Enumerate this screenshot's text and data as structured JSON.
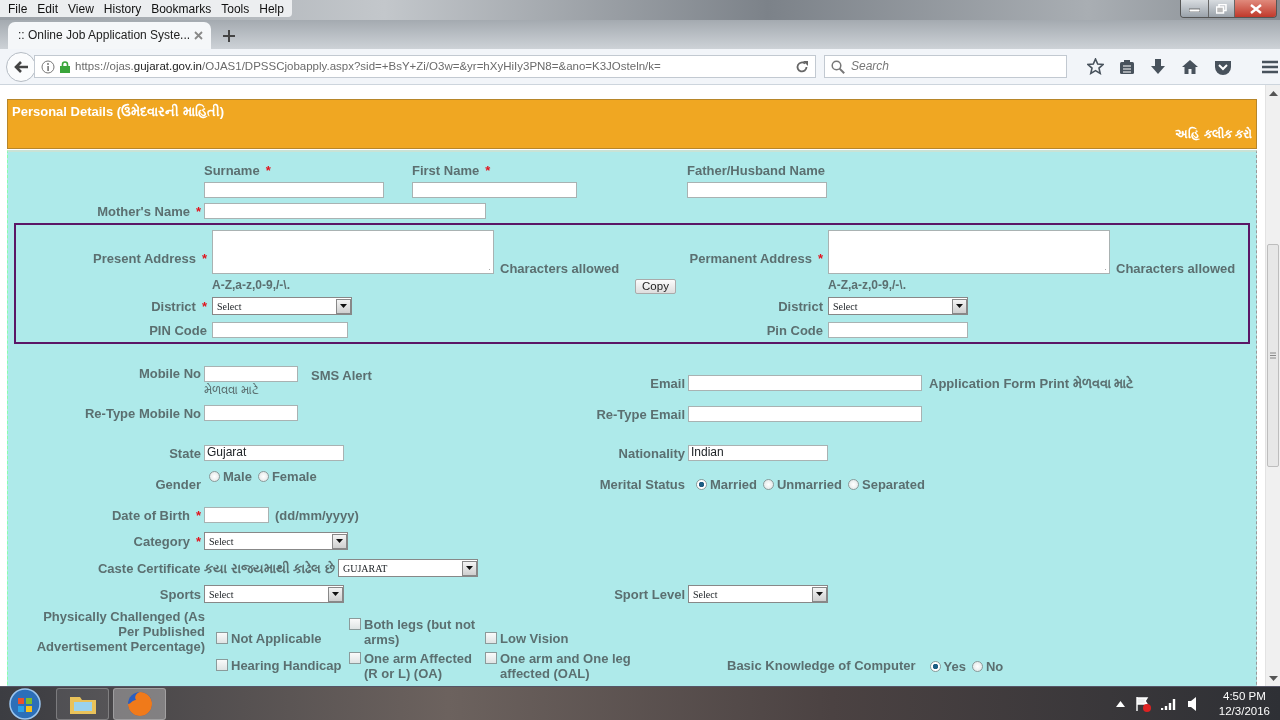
{
  "browser": {
    "menu": [
      "File",
      "Edit",
      "View",
      "History",
      "Bookmarks",
      "Tools",
      "Help"
    ],
    "tabs": [
      {
        "title": ":: Online Job Application Syste...",
        "selected": true
      }
    ],
    "url": "https://ojas.**gujarat.gov.in**/OJAS1/DPSSCjobapply.aspx?sid=+BsY+Zi/O3w=&yr=hXyHiIy3PN8=&ano=K3JOsteln/k=",
    "search": {
      "placeholder": "Search"
    }
  },
  "section": {
    "title": "Personal Details (ઉમેદવારની માહિતી)",
    "link": "અહિ ક્લીક કરો"
  },
  "names": [
    {
      "label": "Surname",
      "mark": "*"
    },
    {
      "label": "First Name",
      "mark": "*"
    },
    {
      "label": "Father/Husband Name"
    }
  ],
  "mother": {
    "label": "Mother's Name",
    "mark": "*"
  },
  "addresses": [
    {
      "label": "Present Address",
      "mark": "*",
      "note": "Characters allowed",
      "pattern": "A-Z,a-z,0-9,/-\\.",
      "district": {
        "label": "District",
        "mark": "*",
        "value": "Select"
      },
      "pin": {
        "label": "PIN Code"
      }
    },
    {
      "label": "Permanent Address",
      "mark": "*",
      "note": "Characters allowed",
      "pattern": "A-Z,a-z,0-9,/-\\.",
      "district": {
        "label": "District",
        "value": "Select"
      },
      "pin": {
        "label": "Pin Code"
      }
    }
  ],
  "copy_button": "Copy",
  "mobile": {
    "label": "Mobile No",
    "note": "SMS Alert",
    "subnote": "મેળવવા માટે"
  },
  "retype_mobile": {
    "label": "Re-Type Mobile No"
  },
  "email": {
    "label": "Email",
    "note": "Application Form Print મેળવવા માટે"
  },
  "retype_email": {
    "label": "Re-Type Email"
  },
  "state": {
    "label": "State",
    "value": "Gujarat"
  },
  "nationality": {
    "label": "Nationality",
    "value": "Indian"
  },
  "gender": {
    "label": "Gender",
    "options": [
      {
        "label": "Male",
        "selected": false
      },
      {
        "label": "Female",
        "selected": false
      }
    ]
  },
  "marital_status": {
    "label": "Merital Status",
    "options": [
      {
        "label": "Married",
        "selected": true
      },
      {
        "label": "Unmarried",
        "selected": false
      },
      {
        "label": "Separated",
        "selected": false
      }
    ]
  },
  "date_of_birth": {
    "label": "Date of Birth",
    "mark": "*",
    "hint": "(dd/mm/yyyy)"
  },
  "category": {
    "label": "Category",
    "mark": "*",
    "value": "Select"
  },
  "caste_certificate": {
    "label": "Caste Certificate કયા રાજયમાથી કાઢેલ છે",
    "value": "GUJARAT"
  },
  "sports": {
    "label": "Sports",
    "value": "Select"
  },
  "sport_level": {
    "label": "Sport Level",
    "value": "Select"
  },
  "physically_challenged": {
    "label": "Physically Challenged (As Per Published Advertisement Percentage)",
    "options": [
      {
        "label": "Not Applicable",
        "checked": false
      },
      {
        "label": "Both legs (but not arms)",
        "checked": false
      },
      {
        "label": "Low Vision",
        "checked": false
      },
      {
        "label": "Hearing Handicap",
        "checked": false
      },
      {
        "label": "One arm Affected (R or L) (OA)",
        "checked": false
      },
      {
        "label": "One arm and One leg affected (OAL)",
        "checked": false
      }
    ]
  },
  "computer_knowledge": {
    "label": "Basic Knowledge of Computer",
    "options": [
      {
        "label": "Yes",
        "selected": true
      },
      {
        "label": "No",
        "selected": false
      }
    ]
  },
  "taskbar": {
    "time": "4:50 PM",
    "date": "12/3/2016"
  }
}
